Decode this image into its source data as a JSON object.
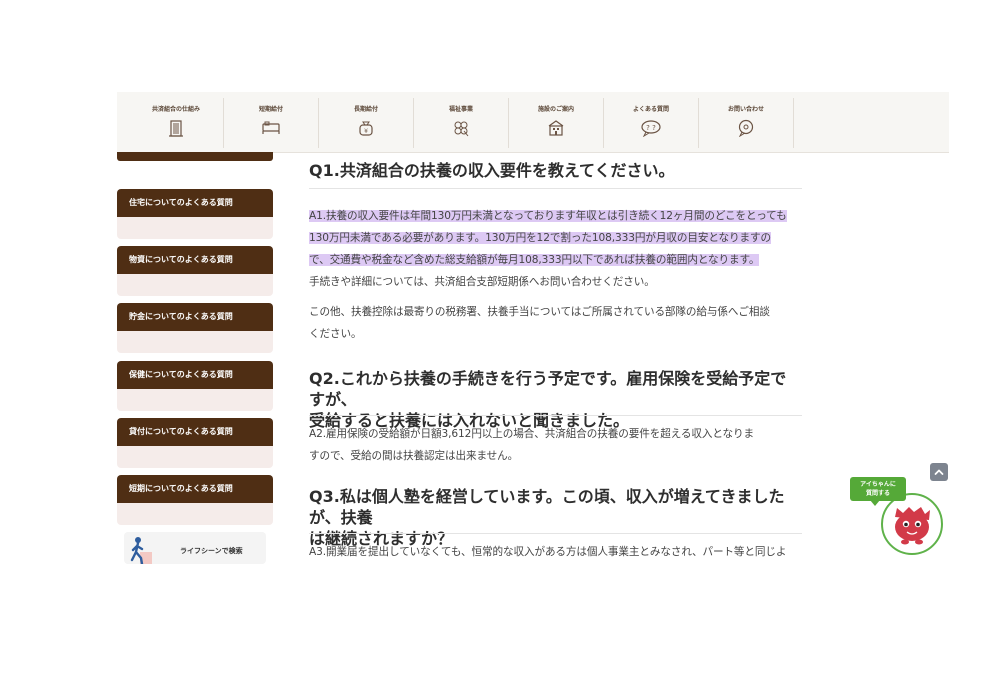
{
  "nav": {
    "items": [
      {
        "label": "共済組合の仕組み",
        "icon": "building-icon"
      },
      {
        "label": "短期給付",
        "icon": "bed-icon"
      },
      {
        "label": "長期給付",
        "icon": "money-bag-icon"
      },
      {
        "label": "福祉事業",
        "icon": "clover-icon"
      },
      {
        "label": "施設のご案内",
        "icon": "facility-icon"
      },
      {
        "label": "よくある質問",
        "icon": "question-bubble-icon"
      },
      {
        "label": "お問い合わせ",
        "icon": "chat-bubble-icon"
      }
    ]
  },
  "sidebar": {
    "items": [
      {
        "label": "住宅についてのよくある質問"
      },
      {
        "label": "物資についてのよくある質問"
      },
      {
        "label": "貯金についてのよくある質問"
      },
      {
        "label": "保健についてのよくある質問"
      },
      {
        "label": "貸付についてのよくある質問"
      },
      {
        "label": "短期についてのよくある質問"
      }
    ],
    "lifescene_label": "ライフシーンで検索"
  },
  "content": {
    "q1": {
      "title": "Q1.共済組合の扶養の収入要件を教えてください。",
      "a_line1": "A1.扶養の収入要件は年間130万円未満となっております年収とは引き続く12ヶ月間のどこをとっても",
      "a_line2": "130万円未満である必要があります。130万円を12で割った108,333円が月収の目安となりますの",
      "a_line3": "で、交通費や税金など含めた総支給額が毎月108,333円以下であれば扶養の範囲内となります。",
      "a_line4": "手続きや詳細については、共済組合支部短期係へお問い合わせください。",
      "b_line1": "この他、扶養控除は最寄りの税務署、扶養手当についてはご所属されている部隊の給与係へご相談",
      "b_line2": "ください。"
    },
    "q2": {
      "title_line1": "Q2.これから扶養の手続きを行う予定です。雇用保険を受給予定ですが、",
      "title_line2": "受給すると扶養には入れないと聞きました。",
      "a_line1": "A2.雇用保険の受給額が日額3,612円以上の場合、共済組合の扶養の要件を超える収入となりま",
      "a_line2": "すので、受給の間は扶養認定は出来ません。"
    },
    "q3": {
      "title_line1": "Q3.私は個人塾を経営しています。この頃、収入が増えてきましたが、扶養",
      "title_line2": "は継続されますか？",
      "a_line1": "A3.開業届を提出していなくても、恒常的な収入がある方は個人事業主とみなされ、パート等と同じよ"
    }
  },
  "widgets": {
    "ai_line1": "アイちゃんに",
    "ai_line2": "質問する"
  },
  "colors": {
    "sidebar_brown": "#4f2e14",
    "highlight": "#ddc9f4",
    "ai_green": "#55a938"
  }
}
